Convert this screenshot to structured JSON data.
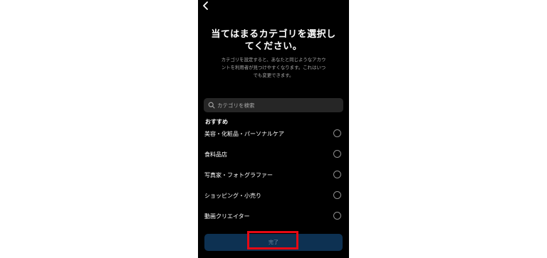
{
  "header": {
    "back_icon": "chevron-left-icon",
    "title_line1": "当てはまるカテゴリを選択し",
    "title_line2": "てください。",
    "description_line1": "カテゴリを設定すると、あなたと同じようなアカウ",
    "description_line2": "ントを利用者が見つけやすくなります。これはいつ",
    "description_line3": "でも変更できます。"
  },
  "search": {
    "icon": "search-icon",
    "placeholder": "カテゴリを検索",
    "value": ""
  },
  "section_title": "おすすめ",
  "categories": [
    {
      "label": "美容・化粧品・パーソナルケア",
      "selected": false
    },
    {
      "label": "食料品店",
      "selected": false
    },
    {
      "label": "写真家・フォトグラファー",
      "selected": false
    },
    {
      "label": "ショッピング・小売り",
      "selected": false
    },
    {
      "label": "動画クリエイター",
      "selected": false
    }
  ],
  "done_button": {
    "label": "完了"
  },
  "colors": {
    "background": "#000000",
    "search_bg": "#262626",
    "button_bg": "#0d3152",
    "button_text": "#6f8aa3",
    "highlight": "#e50914"
  }
}
